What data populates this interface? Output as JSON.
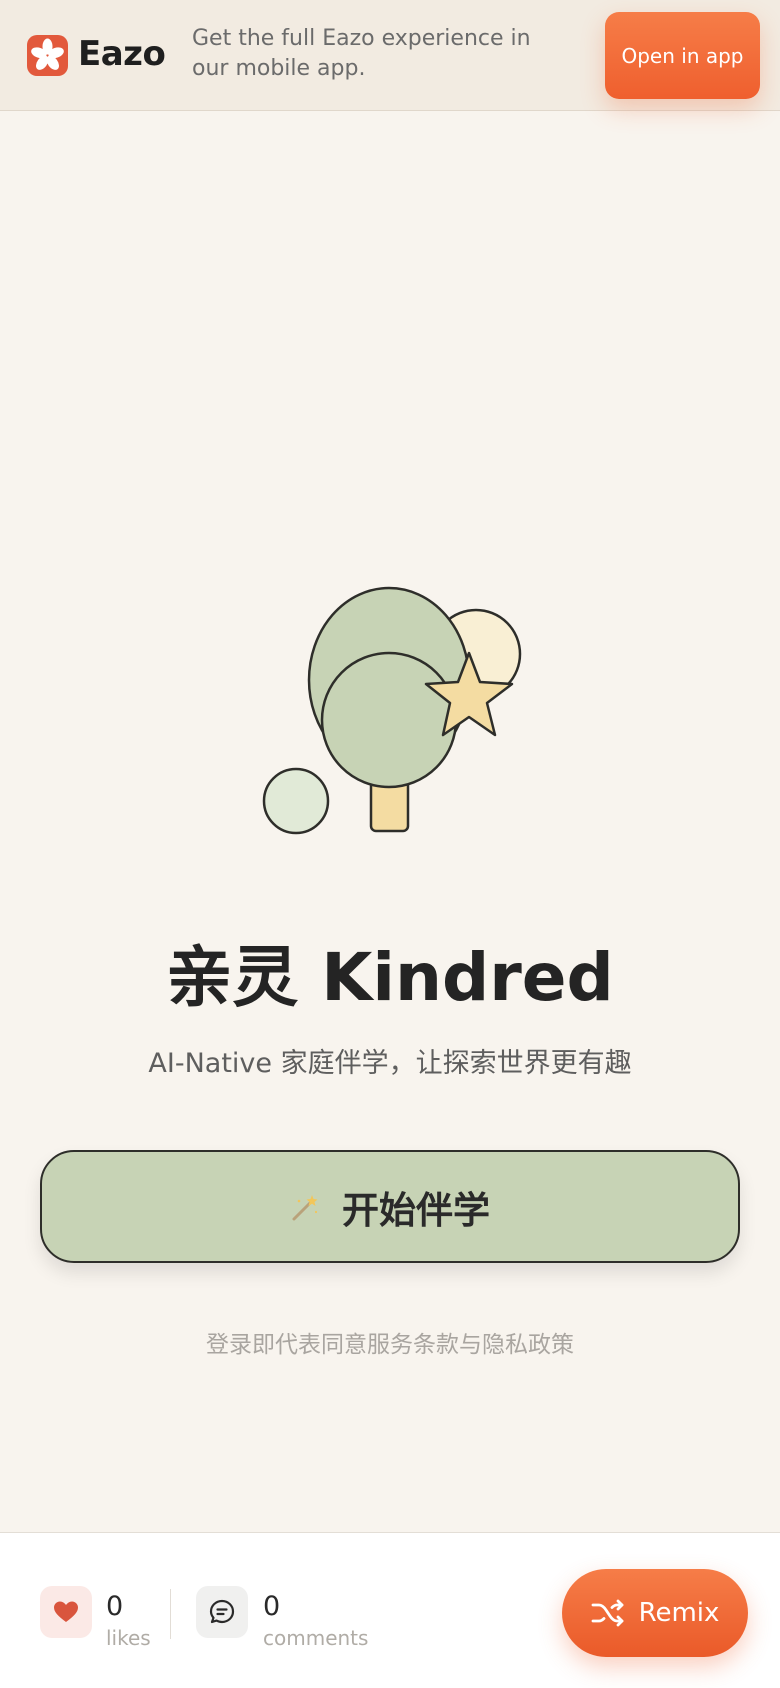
{
  "banner": {
    "brand_name": "Eazo",
    "message": "Get the full Eazo experience in our mobile app.",
    "open_button": "Open in app"
  },
  "hero": {
    "title": "亲灵 Kindred",
    "subtitle": "AI-Native 家庭伴学，让探索世界更有趣",
    "start_button": "开始伴学",
    "start_icon": "magic-wand-icon",
    "terms": "登录即代表同意服务条款与隐私政策"
  },
  "stats": {
    "likes_count": "0",
    "likes_label": "likes",
    "comments_count": "0",
    "comments_label": "comments"
  },
  "remix": {
    "label": "Remix",
    "icon": "shuffle-icon"
  },
  "colors": {
    "accent": "#ef5f2e",
    "background": "#f8f4ee",
    "sage": "#c7d3b5",
    "star": "#f4dca2"
  }
}
